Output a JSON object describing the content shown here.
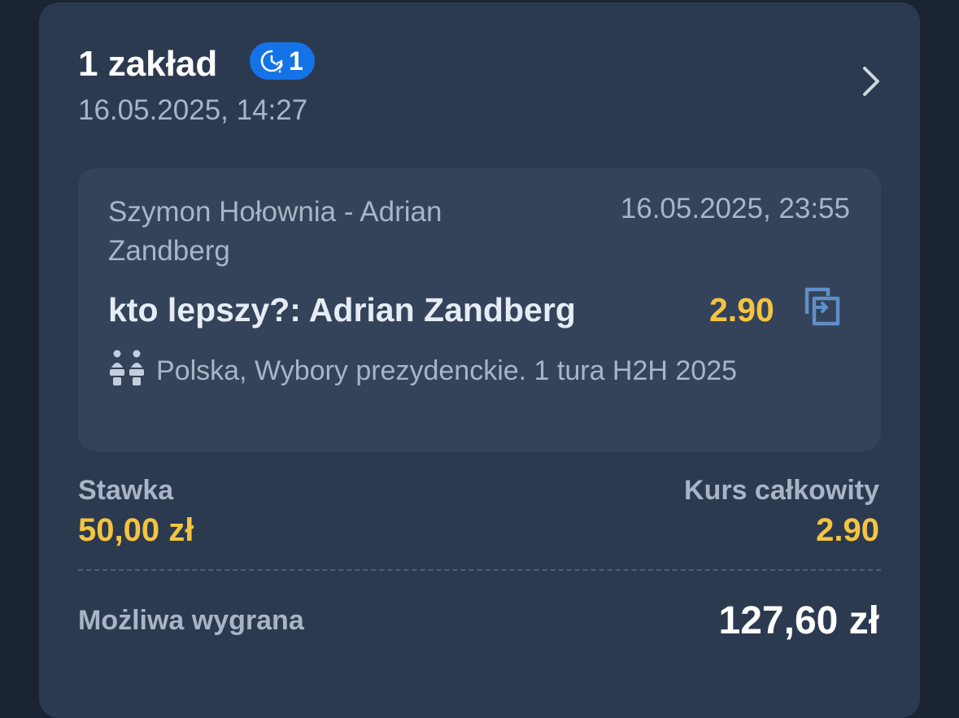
{
  "header": {
    "title": "1 zakład",
    "badge_count": "1",
    "date": "16.05.2025, 14:27"
  },
  "event": {
    "name": "Szymon Hołownia - Adrian Zandberg",
    "date": "16.05.2025, 23:55",
    "selection": "kto lepszy?: Adrian Zandberg",
    "odds": "2.90",
    "league": "Polska, Wybory prezydenckie. 1 tura H2H 2025"
  },
  "summary": {
    "stake_label": "Stawka",
    "stake_value": "50,00 zł",
    "total_odds_label": "Kurs całkowity",
    "total_odds_value": "2.90",
    "win_label": "Możliwa wygrana",
    "win_value": "127,60 zł"
  },
  "icons": {
    "badge": "clock-question-icon",
    "chevron": "chevron-right-icon",
    "swap": "copy-swap-icon",
    "league": "politics-icon"
  },
  "colors": {
    "accent_blue": "#1573e8",
    "odds_yellow": "#f4c441",
    "card_bg": "#2c3a50",
    "event_bg": "#344359"
  }
}
